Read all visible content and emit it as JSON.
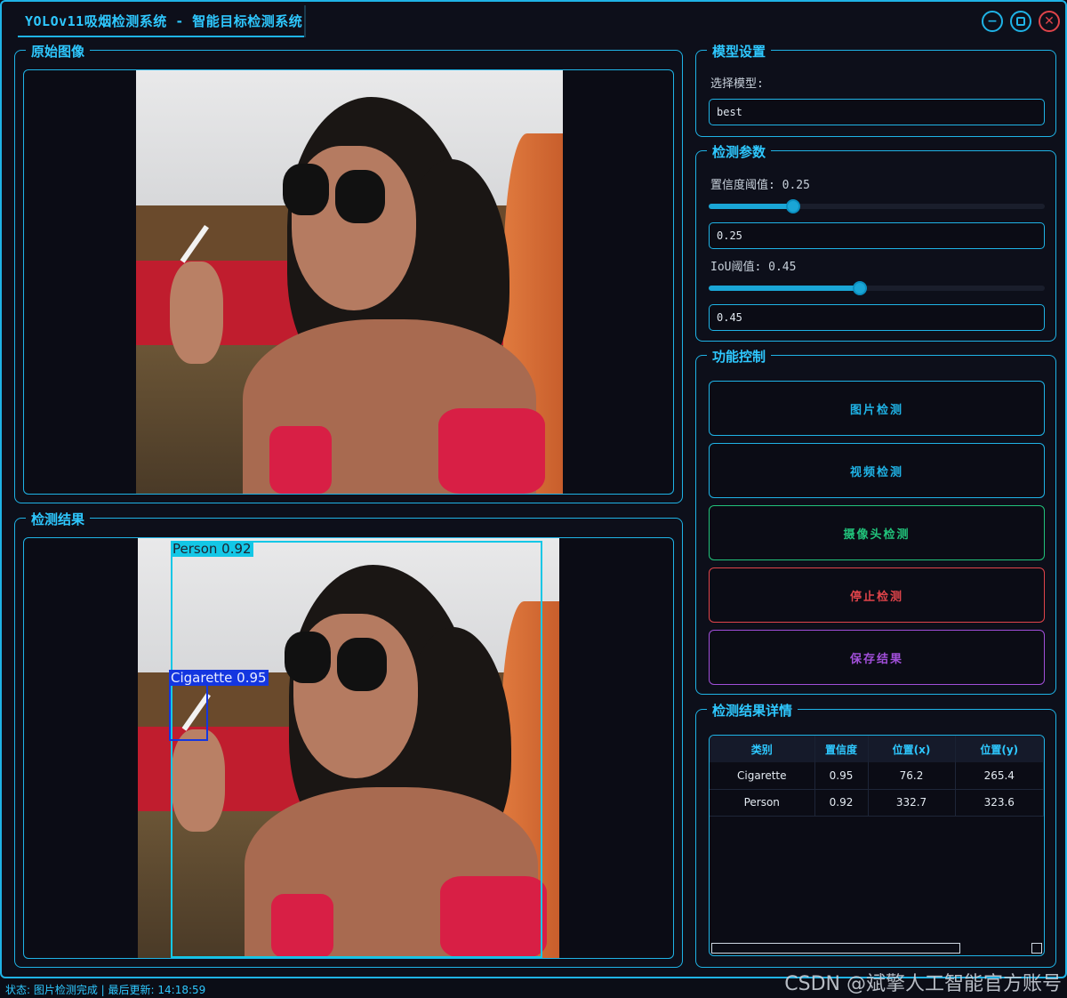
{
  "window": {
    "title": "YOLOv11吸烟检测系统 - 智能目标检测系统",
    "minimize_icon": "minimize-icon",
    "maximize_icon": "maximize-icon",
    "close_icon": "close-icon"
  },
  "original_panel": {
    "title": "原始图像"
  },
  "result_panel": {
    "title": "检测结果",
    "detections": [
      {
        "label": "Person 0.92",
        "color": "#13c7e6"
      },
      {
        "label": "Cigarette 0.95",
        "color": "#1436e0"
      }
    ]
  },
  "model_settings": {
    "title": "模型设置",
    "select_label": "选择模型:",
    "selected_model": "best"
  },
  "params": {
    "title": "检测参数",
    "confidence_label": "置信度阈值: 0.25",
    "confidence_value": "0.25",
    "confidence_level": 0.25,
    "iou_label": "IoU阈值: 0.45",
    "iou_value": "0.45",
    "iou_level": 0.45
  },
  "controls": {
    "title": "功能控制",
    "image_detect": "图片检测",
    "video_detect": "视频检测",
    "camera_detect": "摄像头检测",
    "stop_detect": "停止检测",
    "save_results": "保存结果",
    "colors": {
      "image": "#1fb3e6",
      "video": "#1fb3e6",
      "camera": "#21c27a",
      "stop": "#e0444a",
      "save": "#a14fd9"
    }
  },
  "details": {
    "title": "检测结果详情",
    "headers": [
      "类别",
      "置信度",
      "位置(x)",
      "位置(y)"
    ],
    "rows": [
      [
        "Cigarette",
        "0.95",
        "76.2",
        "265.4"
      ],
      [
        "Person",
        "0.92",
        "332.7",
        "323.6"
      ]
    ]
  },
  "status": {
    "text": "状态: 图片检测完成 | 最后更新: 14:18:59"
  },
  "watermark": "CSDN @斌擎人工智能官方账号"
}
